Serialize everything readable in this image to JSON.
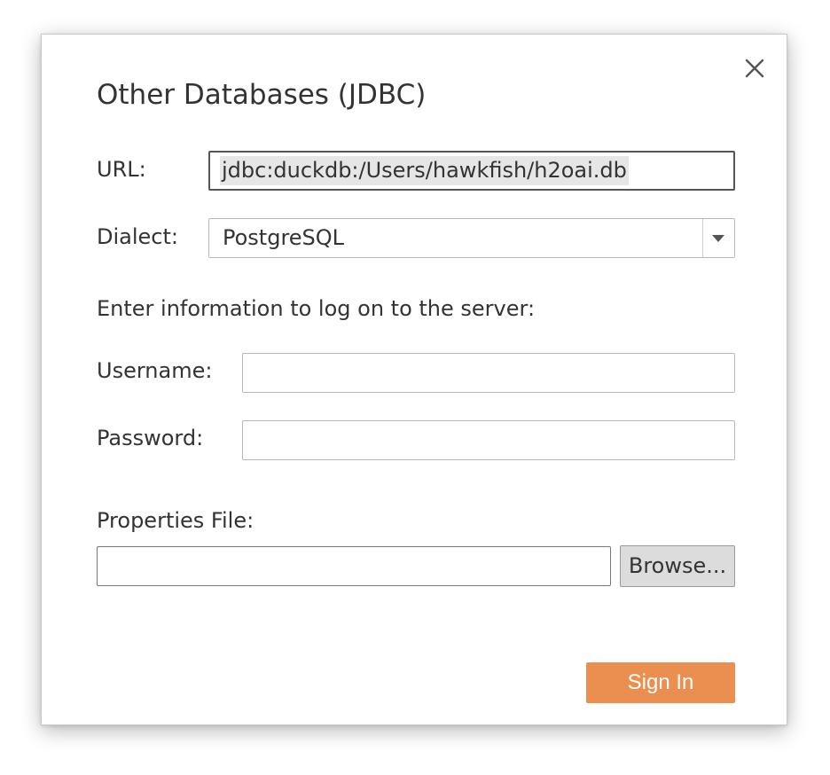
{
  "dialog": {
    "title": "Other Databases (JDBC)",
    "close_icon": "close-icon"
  },
  "url": {
    "label": "URL:",
    "value": "jdbc:duckdb:/Users/hawkfish/h2oai.db"
  },
  "dialect": {
    "label": "Dialect:",
    "selected": "PostgreSQL",
    "arrow_icon": "dropdown-arrow-icon"
  },
  "logon": {
    "heading": "Enter information to log on to the server:",
    "username_label": "Username:",
    "username_value": "",
    "password_label": "Password:",
    "password_value": ""
  },
  "properties": {
    "label": "Properties File:",
    "value": "",
    "browse_label": "Browse..."
  },
  "actions": {
    "sign_in_label": "Sign In"
  },
  "colors": {
    "accent": "#eb8f50",
    "text": "#333333",
    "border": "#b9b9b9",
    "selection": "#e6e6e6"
  }
}
